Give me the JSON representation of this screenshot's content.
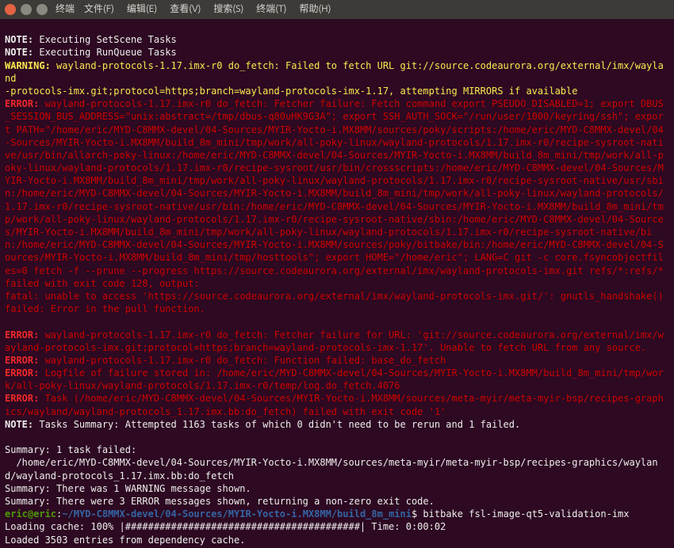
{
  "titlebar": {
    "app_label": "终端",
    "menu": {
      "file": "文件(F)",
      "edit": "编辑(E)",
      "view": "查看(V)",
      "search": "搜索(S)",
      "terminal": "终端(T)",
      "help": "帮助(H)"
    }
  },
  "labels": {
    "note": "NOTE:",
    "warning": "WARNING:",
    "error": "ERROR:"
  },
  "lines": {
    "note1": " Executing SetScene Tasks",
    "note2": " Executing RunQueue Tasks",
    "warn1a": " wayland-protocols-1.17.imx-r0 do_fetch: Failed to fetch URL git://source.codeaurora.org/external/imx/wayland",
    "warn1b": "-protocols-imx.git;protocol=https;branch=wayland-protocols-imx-1.17, attempting MIRRORS if available",
    "err1": " wayland-protocols-1.17.imx-r0 do_fetch: Fetcher failure: Fetch command export PSEUDO_DISABLED=1; export DBUS_SESSION_BUS_ADDRESS=\"unix:abstract=/tmp/dbus-q80uHK9G3A\"; export SSH_AUTH_SOCK=\"/run/user/1000/keyring/ssh\"; export PATH=\"/home/eric/MYD-C8MMX-devel/04-Sources/MYIR-Yocto-i.MX8MM/sources/poky/scripts:/home/eric/MYD-C8MMX-devel/04-Sources/MYIR-Yocto-i.MX8MM/build_8m_mini/tmp/work/all-poky-linux/wayland-protocols/1.17.imx-r0/recipe-sysroot-native/usr/bin/allarch-poky-linux:/home/eric/MYD-C8MMX-devel/04-Sources/MYIR-Yocto-i.MX8MM/build_8m_mini/tmp/work/all-poky-linux/wayland-protocols/1.17.imx-r0/recipe-sysroot/usr/bin/crossscripts:/home/eric/MYD-C8MMX-devel/04-Sources/MYIR-Yocto-i.MX8MM/build_8m_mini/tmp/work/all-poky-linux/wayland-protocols/1.17.imx-r0/recipe-sysroot-native/usr/sbin:/home/eric/MYD-C8MMX-devel/04-Sources/MYIR-Yocto-i.MX8MM/build_8m_mini/tmp/work/all-poky-linux/wayland-protocols/1.17.imx-r0/recipe-sysroot-native/usr/bin:/home/eric/MYD-C8MMX-devel/04-Sources/MYIR-Yocto-i.MX8MM/build_8m_mini/tmp/work/all-poky-linux/wayland-protocols/1.17.imx-r0/recipe-sysroot-native/sbin:/home/eric/MYD-C8MMX-devel/04-Sources/MYIR-Yocto-i.MX8MM/build_8m_mini/tmp/work/all-poky-linux/wayland-protocols/1.17.imx-r0/recipe-sysroot-native/bin:/home/eric/MYD-C8MMX-devel/04-Sources/MYIR-Yocto-i.MX8MM/sources/poky/bitbake/bin:/home/eric/MYD-C8MMX-devel/04-Sources/MYIR-Yocto-i.MX8MM/build_8m_mini/tmp/hosttools\"; export HOME=\"/home/eric\"; LANG=C git -c core.fsyncobjectfiles=0 fetch -f --prune --progress https://source.codeaurora.org/external/imx/wayland-protocols-imx.git refs/*:refs/* failed with exit code 128, output:",
    "err1_fatal": "fatal: unable to access 'https://source.codeaurora.org/external/imx/wayland-protocols-imx.git/': gnutls_handshake() failed: Error in the pull function.",
    "err2": " wayland-protocols-1.17.imx-r0 do_fetch: Fetcher failure for URL: 'git://source.codeaurora.org/external/imx/wayland-protocols-imx.git;protocol=https;branch=wayland-protocols-imx-1.17'. Unable to fetch URL from any source.",
    "err3": " wayland-protocols-1.17.imx-r0 do_fetch: Function failed: base_do_fetch",
    "err4": " Logfile of failure stored in: /home/eric/MYD-C8MMX-devel/04-Sources/MYIR-Yocto-i.MX8MM/build_8m_mini/tmp/work/all-poky-linux/wayland-protocols/1.17.imx-r0/temp/log.do_fetch.4076",
    "err5": " Task (/home/eric/MYD-C8MMX-devel/04-Sources/MYIR-Yocto-i.MX8MM/sources/meta-myir/meta-myir-bsp/recipes-graphics/wayland/wayland-protocols_1.17.imx.bb:do_fetch) failed with exit code '1'",
    "note3": " Tasks Summary: Attempted 1163 tasks of which 0 didn't need to be rerun and 1 failed.",
    "summary_hdr": "Summary: 1 task failed:",
    "summary_path": "  /home/eric/MYD-C8MMX-devel/04-Sources/MYIR-Yocto-i.MX8MM/sources/meta-myir/meta-myir-bsp/recipes-graphics/wayland/wayland-protocols_1.17.imx.bb:do_fetch",
    "summary_w": "Summary: There was 1 WARNING message shown.",
    "summary_e": "Summary: There were 3 ERROR messages shown, returning a non-zero exit code.",
    "prompt_user": "eric@eric",
    "prompt_sep": ":",
    "prompt_path": "~/MYD-C8MMX-devel/04-Sources/MYIR-Yocto-i.MX8MM/build_8m_mini",
    "prompt_dollar": "$ ",
    "command": "bitbake fsl-image-qt5-validation-imx",
    "cache": "Loading cache: 100% |#########################################| Time: 0:00:02",
    "loaded": "Loaded 3503 entries from dependency cache."
  }
}
